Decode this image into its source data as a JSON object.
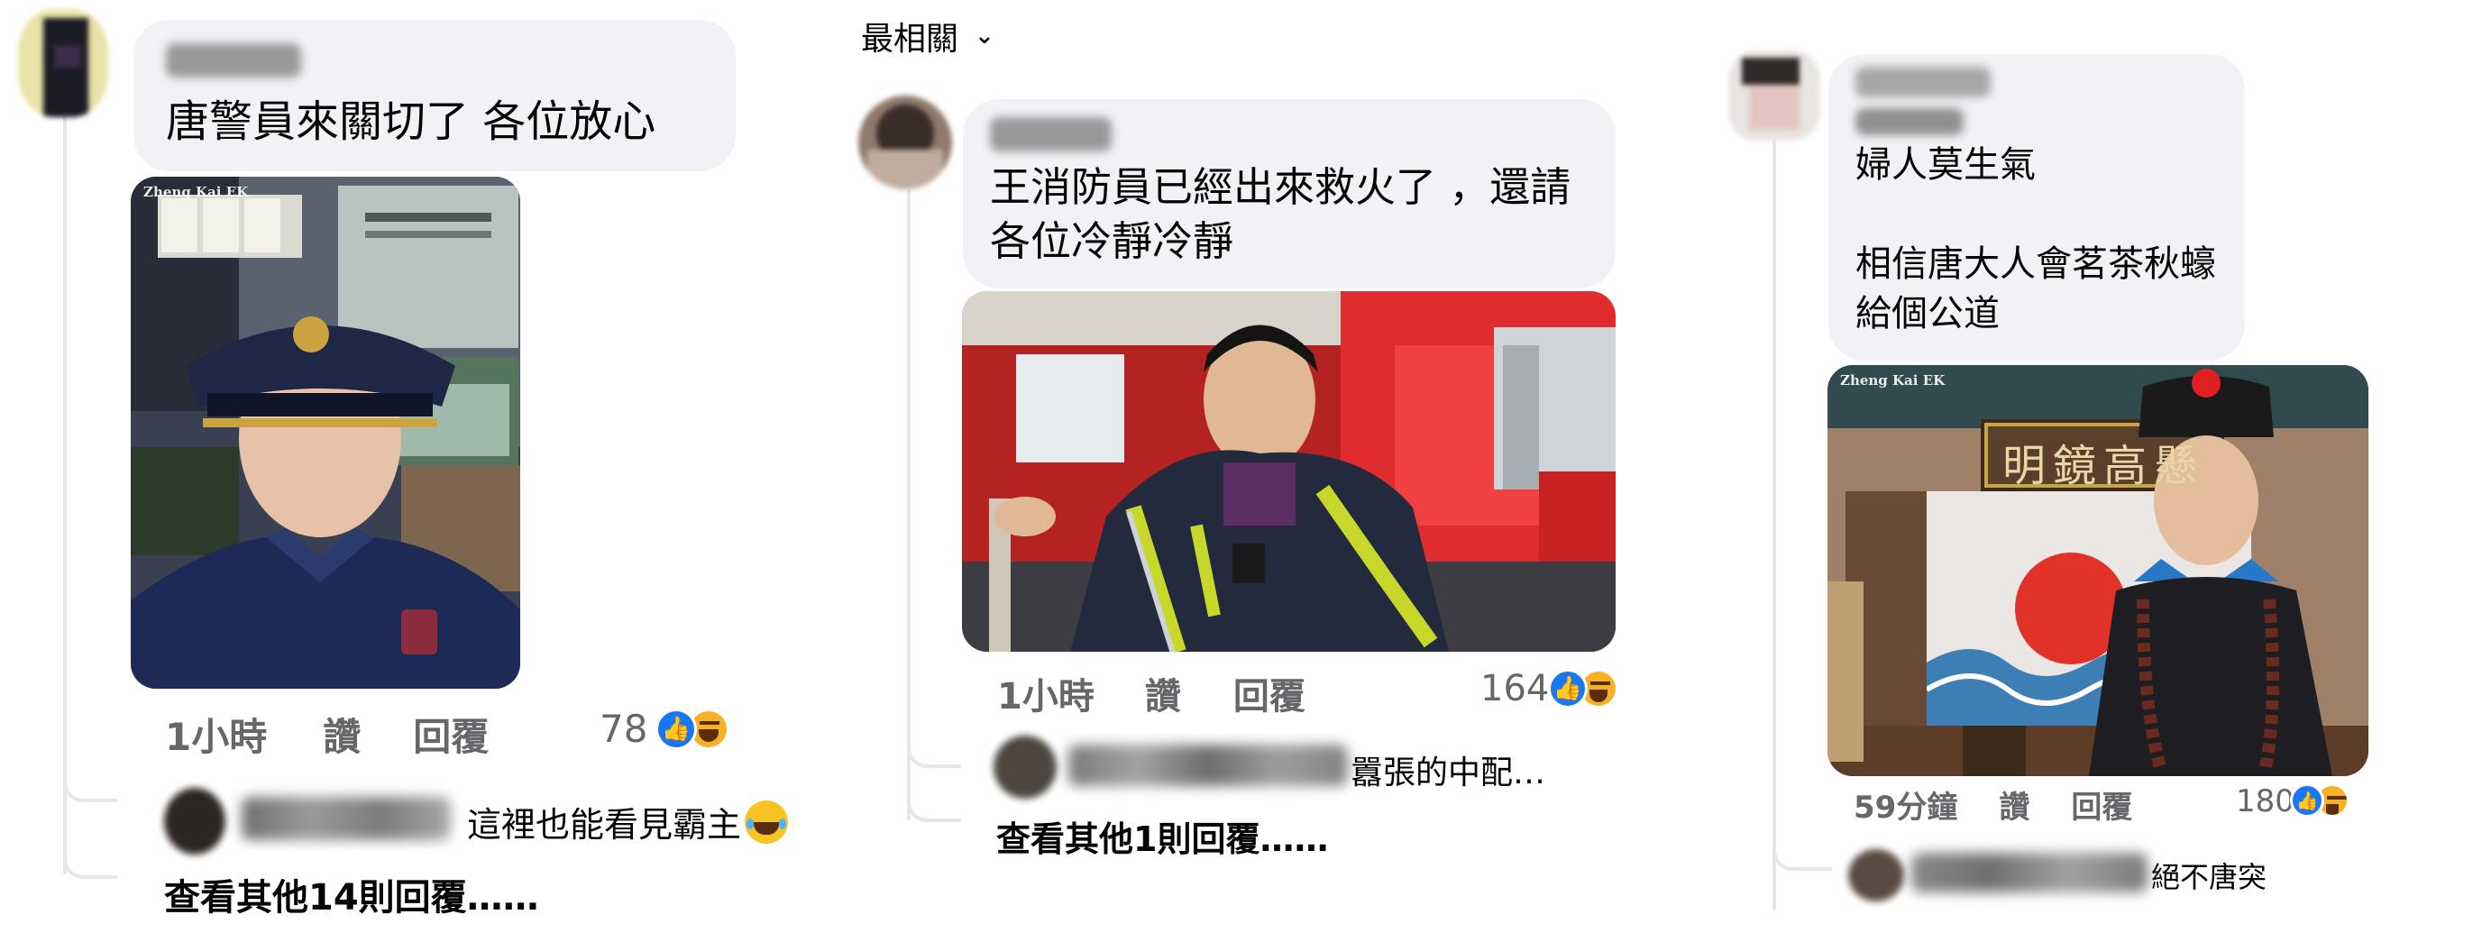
{
  "sort": {
    "label": "最相關",
    "chevron": "chevron-down-icon"
  },
  "panels": [
    {
      "comment": {
        "text": "唐警員來關切了 各位放心"
      },
      "photo": {
        "watermark": "Zheng Kai EK"
      },
      "meta": {
        "time": "1小時",
        "like": "讚",
        "reply": "回覆",
        "reactions": "78"
      },
      "reply_preview": {
        "text": "這裡也能看見霸主"
      },
      "more_replies": "查看其他14則回覆……"
    },
    {
      "comment": {
        "text": "王消防員已經出來救火了 ，還請\n各位冷靜冷靜"
      },
      "meta": {
        "time": "1小時",
        "like": "讚",
        "reply": "回覆",
        "reactions": "164"
      },
      "reply_preview": {
        "text": "囂張的中配…"
      },
      "more_replies": "查看其他1則回覆……"
    },
    {
      "comment": {
        "text": "婦人莫生氣\n\n相信唐大人會茗茶秋蠔\n給個公道"
      },
      "photo": {
        "watermark": "Zheng Kai EK",
        "plaque": "明鏡高懸"
      },
      "meta": {
        "time": "59分鐘",
        "like": "讚",
        "reply": "回覆",
        "reactions": "180"
      },
      "reply_preview": {
        "text": "絕不唐突"
      }
    }
  ],
  "colors": {
    "like_blue": "#1877f2",
    "bubble_bg": "#f0f2f5",
    "meta_gray": "#65676b"
  }
}
